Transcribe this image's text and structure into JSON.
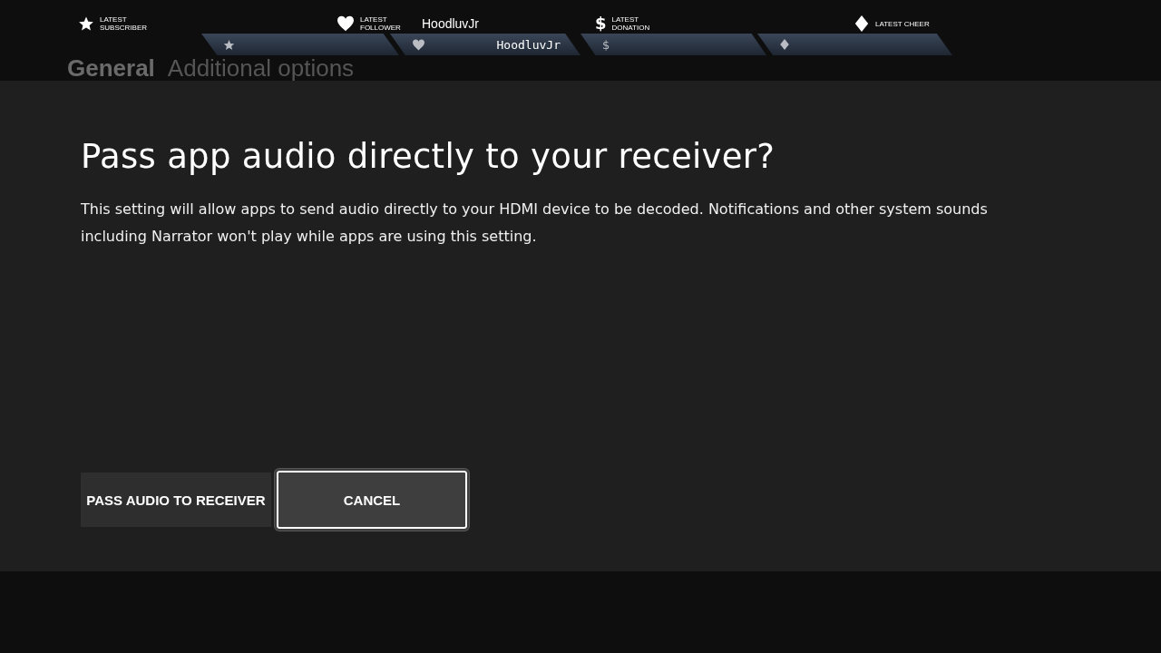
{
  "header": {
    "tabs": [
      {
        "label": "General",
        "selected": true
      },
      {
        "label": "Additional options",
        "selected": false
      }
    ]
  },
  "overlay": {
    "widgets": [
      {
        "kind": "subscriber",
        "label": "LATEST SUBSCRIBER"
      },
      {
        "kind": "follower",
        "label": "LATEST FOLLOWER",
        "name": "HoodluvJr",
        "bar_name": "HoodluvJr"
      },
      {
        "kind": "donation",
        "label": "LATEST DONATION",
        "symbol": "$",
        "bar_symbol": "$"
      },
      {
        "kind": "cheer",
        "label": "LATEST CHEER"
      }
    ]
  },
  "dialog": {
    "title": "Pass app audio directly to your receiver?",
    "body": "This setting will allow apps to send audio directly to your HDMI device to be decoded. Notifications and other system sounds including Narrator won't play while apps are using this setting.",
    "buttons": [
      {
        "label": "PASS AUDIO TO RECEIVER",
        "selected": false
      },
      {
        "label": "CANCEL",
        "selected": true
      }
    ]
  }
}
